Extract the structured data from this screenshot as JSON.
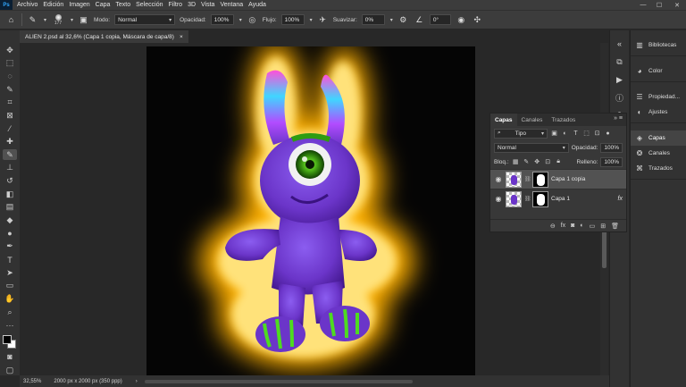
{
  "app": {
    "logo": "Ps"
  },
  "menu": [
    "Archivo",
    "Edición",
    "Imagen",
    "Capa",
    "Texto",
    "Selección",
    "Filtro",
    "3D",
    "Vista",
    "Ventana",
    "Ayuda"
  ],
  "window_controls": {
    "minimize": "—",
    "maximize": "☐",
    "close": "✕"
  },
  "options": {
    "brush_size": "177",
    "mode_label": "Modo:",
    "mode_value": "Normal",
    "opacity_label": "Opacidad:",
    "opacity_value": "100%",
    "flow_label": "Flujo:",
    "flow_value": "100%",
    "smooth_label": "Suavizar:",
    "smooth_value": "0%",
    "angle_value": "0°"
  },
  "document": {
    "tab_title": "ALIEN 2.psd al 32,6% (Capa 1 copia, Máscara de capa/8)",
    "close": "×"
  },
  "status": {
    "zoom": "32,55%",
    "info": "2000 px x 2000 px (350 ppp)"
  },
  "dock": {
    "groups": [
      [
        {
          "icon": "library-icon",
          "label": "Bibliotecas"
        }
      ],
      [
        {
          "icon": "color-icon",
          "label": "Color"
        }
      ],
      [
        {
          "icon": "properties-icon",
          "label": "Propiedad..."
        },
        {
          "icon": "adjustments-icon",
          "label": "Ajustes"
        }
      ],
      [
        {
          "icon": "layers-icon",
          "label": "Capas",
          "active": true
        },
        {
          "icon": "channels-icon",
          "label": "Canales"
        },
        {
          "icon": "paths-icon",
          "label": "Trazados"
        }
      ]
    ]
  },
  "layers_panel": {
    "tabs": [
      "Capas",
      "Canales",
      "Trazados"
    ],
    "kind_filter": "Tipo",
    "blend_mode": "Normal",
    "opacity_label": "Opacidad:",
    "opacity_value": "100%",
    "lock_label": "Bloq.:",
    "fill_label": "Relleno:",
    "fill_value": "100%",
    "layers": [
      {
        "name": "Capa 1 copia",
        "selected": true,
        "fx": ""
      },
      {
        "name": "Capa 1",
        "selected": false,
        "fx": "fx"
      }
    ]
  },
  "colors": {
    "accent": "#31a8ff",
    "glow": "#ffc21a",
    "alien_body": "#6b35c9",
    "eye_green": "#58c21e",
    "foreground": "#000000",
    "background": "#ffffff"
  }
}
